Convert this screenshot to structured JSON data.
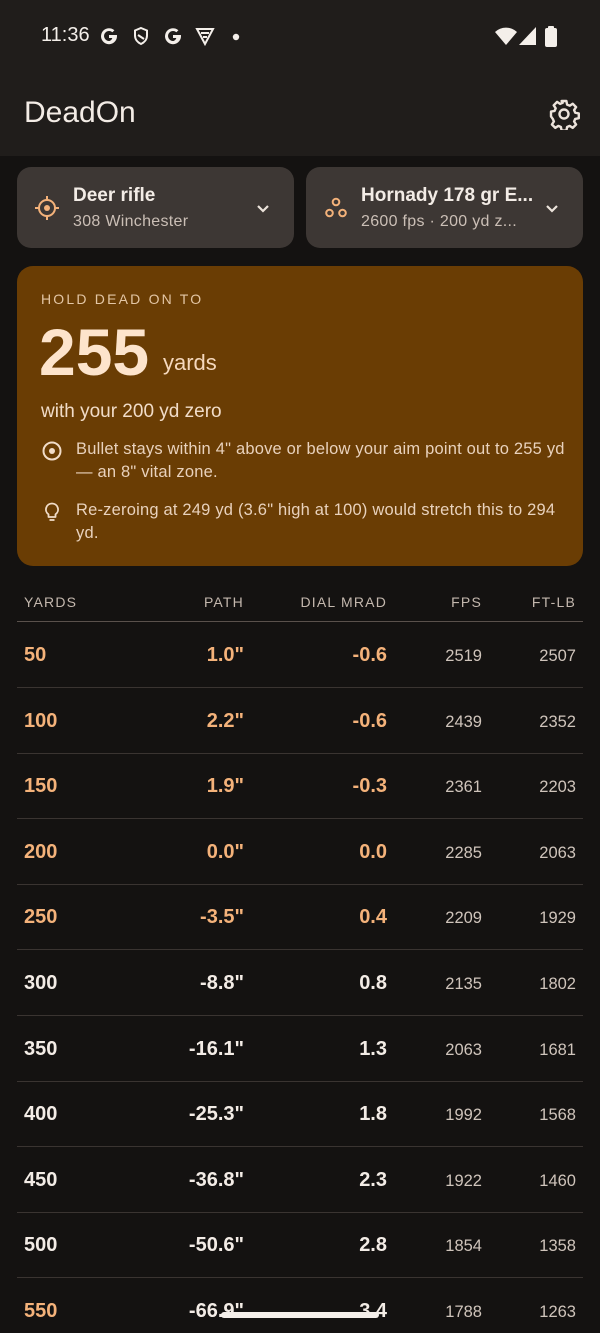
{
  "status_bar": {
    "time": "11:36",
    "icons": [
      "g-icon",
      "shield-icon",
      "g-icon",
      "vpn-icon",
      "dot-icon",
      "wifi-icon",
      "signal-icon",
      "battery-icon"
    ]
  },
  "app_bar": {
    "title": "DeadOn",
    "settings_icon": "gear-icon"
  },
  "rifle_selector": {
    "title": "Deer rifle",
    "subtitle": "308 Winchester",
    "icon": "crosshair-icon"
  },
  "load_selector": {
    "title": "Hornady 178 gr E...",
    "subtitle": "2600 fps · 200 yd z...",
    "icon": "bullets-icon"
  },
  "hold_card": {
    "eyebrow": "HOLD DEAD ON TO",
    "distance": "255",
    "unit": "yards",
    "subtitle": "with your 200 yd zero",
    "notes": [
      {
        "icon": "target-icon",
        "text": "Bullet stays within 4\" above or below your aim point out to 255 yd — an 8\" vital zone."
      },
      {
        "icon": "lightbulb-icon",
        "text": "Re-zeroing at 249 yd (3.6\" high at 100) would stretch this to 294 yd."
      }
    ]
  },
  "table": {
    "headers": {
      "yards": "YARDS",
      "path": "PATH",
      "dial": "DIAL MRAD",
      "fps": "FPS",
      "ftlb": "FT-LB"
    },
    "rows": [
      {
        "yards": "50",
        "path": "1.0\"",
        "dial": "-0.6",
        "fps": "2519",
        "ftlb": "2507"
      },
      {
        "yards": "100",
        "path": "2.2\"",
        "dial": "-0.6",
        "fps": "2439",
        "ftlb": "2352"
      },
      {
        "yards": "150",
        "path": "1.9\"",
        "dial": "-0.3",
        "fps": "2361",
        "ftlb": "2203"
      },
      {
        "yards": "200",
        "path": "0.0\"",
        "dial": "0.0",
        "fps": "2285",
        "ftlb": "2063"
      },
      {
        "yards": "250",
        "path": "-3.5\"",
        "dial": "0.4",
        "fps": "2209",
        "ftlb": "1929"
      },
      {
        "yards": "300",
        "path": "-8.8\"",
        "dial": "0.8",
        "fps": "2135",
        "ftlb": "1802"
      },
      {
        "yards": "350",
        "path": "-16.1\"",
        "dial": "1.3",
        "fps": "2063",
        "ftlb": "1681"
      },
      {
        "yards": "400",
        "path": "-25.3\"",
        "dial": "1.8",
        "fps": "1992",
        "ftlb": "1568"
      },
      {
        "yards": "450",
        "path": "-36.8\"",
        "dial": "2.3",
        "fps": "1922",
        "ftlb": "1460"
      },
      {
        "yards": "500",
        "path": "-50.6\"",
        "dial": "2.8",
        "fps": "1854",
        "ftlb": "1358"
      },
      {
        "yards": "550",
        "path": "-66.9\"",
        "dial": "3.4",
        "fps": "1788",
        "ftlb": "1263"
      }
    ]
  },
  "colors": {
    "accent": "#f4b27a",
    "card": "#6a3d04",
    "background": "#141211",
    "surface": "#3d3734"
  }
}
